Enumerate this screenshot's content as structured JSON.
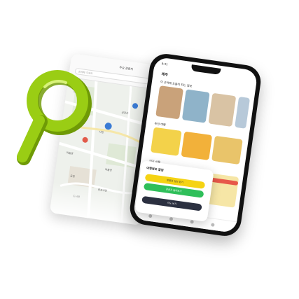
{
  "map": {
    "title": "주요 관광지",
    "search_placeholder": "검색해 주세요",
    "labels": [
      "센트럴파크",
      "시청",
      "금강산",
      "미술관",
      "박물관",
      "공원",
      "한강시장",
      "도서관"
    ]
  },
  "phone": {
    "status_time": "9:41",
    "app_title": "제주",
    "section_1": "이 근처에 도움이 되는 정보",
    "section_2": "추천 여행",
    "section_3": "인기 상품"
  },
  "popup": {
    "title": "여행정보 알림",
    "buttons": [
      "맞춤형 정보 받기",
      "관광지 둘러보기",
      "지도 보기"
    ],
    "colors": {
      "yellow": "#f5d313",
      "green": "#2fbf5a",
      "dark": "#2b3040"
    }
  },
  "colors": {
    "magnifier": "#9acd14",
    "magnifier_dark": "#6f9a06"
  }
}
